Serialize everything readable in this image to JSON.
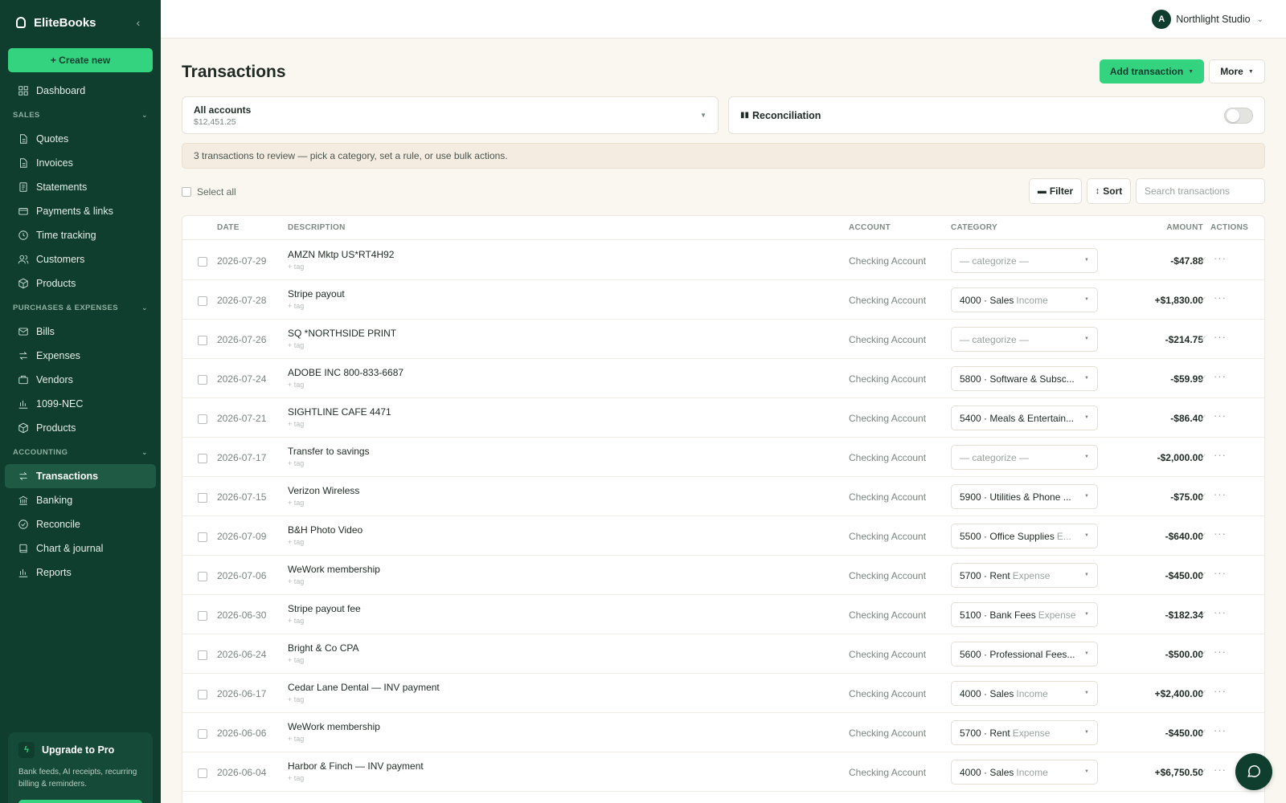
{
  "app": {
    "name": "EliteBooks"
  },
  "sidebar": {
    "create_label": "+ Create new",
    "dashboard": {
      "label": "Dashboard",
      "icon": "grid-icon"
    },
    "sections": [
      {
        "title": "SALES",
        "items": [
          {
            "label": "Quotes",
            "icon": "file-icon"
          },
          {
            "label": "Invoices",
            "icon": "file-icon"
          },
          {
            "label": "Statements",
            "icon": "document-icon"
          },
          {
            "label": "Payments & links",
            "icon": "card-icon"
          },
          {
            "label": "Time tracking",
            "icon": "clock-icon"
          },
          {
            "label": "Customers",
            "icon": "users-icon"
          },
          {
            "label": "Products",
            "icon": "box-icon"
          }
        ]
      },
      {
        "title": "PURCHASES & EXPENSES",
        "items": [
          {
            "label": "Bills",
            "icon": "mail-icon"
          },
          {
            "label": "Expenses",
            "icon": "swap-icon"
          },
          {
            "label": "Vendors",
            "icon": "briefcase-icon"
          },
          {
            "label": "1099-NEC",
            "icon": "bar-chart-icon"
          },
          {
            "label": "Products",
            "icon": "box-icon"
          }
        ]
      },
      {
        "title": "ACCOUNTING",
        "items": [
          {
            "label": "Transactions",
            "icon": "swap-icon",
            "active": true
          },
          {
            "label": "Banking",
            "icon": "bank-icon"
          },
          {
            "label": "Reconcile",
            "icon": "check-circle-icon"
          },
          {
            "label": "Chart & journal",
            "icon": "book-icon"
          },
          {
            "label": "Reports",
            "icon": "bar-chart-icon"
          }
        ]
      }
    ],
    "upgrade": {
      "title": "Upgrade to Pro",
      "desc_line1": "Bank feeds, AI receipts, recurring",
      "desc_line2": "billing & reminders."
    }
  },
  "topbar": {
    "workspace_initial": "A",
    "workspace_name": "Northlight Studio"
  },
  "page": {
    "title": "Transactions",
    "add_label": "Add transaction",
    "more_label": "More",
    "account": {
      "name": "All accounts",
      "balance": "$12,451.25"
    },
    "reconciliation_label": "Reconciliation",
    "reconciliation_on": false,
    "review_banner": "3 transactions to review — pick a category, set a rule, or use bulk actions.",
    "select_all_label": "Select all",
    "filter_label": "Filter",
    "sort_label": "Sort",
    "search_placeholder": "Search transactions"
  },
  "table": {
    "headers": {
      "date": "DATE",
      "description": "DESCRIPTION",
      "account": "ACCOUNT",
      "category": "CATEGORY",
      "amount": "AMOUNT",
      "actions": "ACTIONS"
    },
    "tag_label": "+ tag",
    "rows": [
      {
        "date": "2026-07-29",
        "description": "AMZN Mktp US*RT4H92",
        "account": "Checking Account",
        "category_main": "— categorize —",
        "category_sub": "",
        "empty": true,
        "amount": "-$47.88"
      },
      {
        "date": "2026-07-28",
        "description": "Stripe payout",
        "account": "Checking Account",
        "category_main": "4000 · Sales",
        "category_sub": "Income",
        "empty": false,
        "amount": "+$1,830.00"
      },
      {
        "date": "2026-07-26",
        "description": "SQ *NORTHSIDE PRINT",
        "account": "Checking Account",
        "category_main": "— categorize —",
        "category_sub": "",
        "empty": true,
        "amount": "-$214.75"
      },
      {
        "date": "2026-07-24",
        "description": "ADOBE INC 800-833-6687",
        "account": "Checking Account",
        "category_main": "5800 · Software & Subsc...",
        "category_sub": "",
        "empty": false,
        "amount": "-$59.99"
      },
      {
        "date": "2026-07-21",
        "description": "SIGHTLINE CAFE 4471",
        "account": "Checking Account",
        "category_main": "5400 · Meals & Entertain...",
        "category_sub": "",
        "empty": false,
        "amount": "-$86.40"
      },
      {
        "date": "2026-07-17",
        "description": "Transfer to savings",
        "account": "Checking Account",
        "category_main": "— categorize —",
        "category_sub": "",
        "empty": true,
        "amount": "-$2,000.00"
      },
      {
        "date": "2026-07-15",
        "description": "Verizon Wireless",
        "account": "Checking Account",
        "category_main": "5900 · Utilities & Phone ...",
        "category_sub": "",
        "empty": false,
        "amount": "-$75.00"
      },
      {
        "date": "2026-07-09",
        "description": "B&H Photo Video",
        "account": "Checking Account",
        "category_main": "5500 · Office Supplies",
        "category_sub": "E...",
        "empty": false,
        "amount": "-$640.00"
      },
      {
        "date": "2026-07-06",
        "description": "WeWork membership",
        "account": "Checking Account",
        "category_main": "5700 · Rent",
        "category_sub": "Expense",
        "empty": false,
        "amount": "-$450.00"
      },
      {
        "date": "2026-06-30",
        "description": "Stripe payout fee",
        "account": "Checking Account",
        "category_main": "5100 · Bank Fees",
        "category_sub": "Expense",
        "empty": false,
        "amount": "-$182.34"
      },
      {
        "date": "2026-06-24",
        "description": "Bright & Co CPA",
        "account": "Checking Account",
        "category_main": "5600 · Professional Fees...",
        "category_sub": "",
        "empty": false,
        "amount": "-$500.00"
      },
      {
        "date": "2026-06-17",
        "description": "Cedar Lane Dental — INV payment",
        "account": "Checking Account",
        "category_main": "4000 · Sales",
        "category_sub": "Income",
        "empty": false,
        "amount": "+$2,400.00"
      },
      {
        "date": "2026-06-06",
        "description": "WeWork membership",
        "account": "Checking Account",
        "category_main": "5700 · Rent",
        "category_sub": "Expense",
        "empty": false,
        "amount": "-$450.00"
      },
      {
        "date": "2026-06-04",
        "description": "Harbor & Finch — INV payment",
        "account": "Checking Account",
        "category_main": "4000 · Sales",
        "category_sub": "Income",
        "empty": false,
        "amount": "+$6,750.50"
      }
    ]
  },
  "colors": {
    "sidebar_bg": "#0f3d2e",
    "accent": "#34d37f",
    "page_bg": "#faf7f0"
  }
}
